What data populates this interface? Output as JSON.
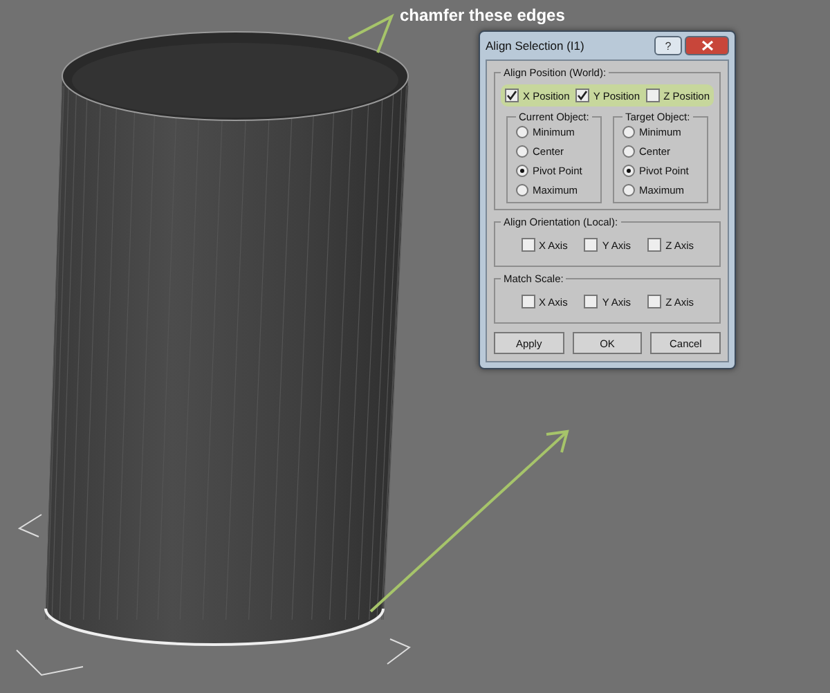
{
  "annotation": "chamfer these edges",
  "dialog": {
    "title": "Align Selection (I1)",
    "help": "?",
    "position": {
      "label": "Align Position (World):",
      "highlighted": true,
      "axes": [
        {
          "label": "X Position",
          "checked": true
        },
        {
          "label": "Y Position",
          "checked": true
        },
        {
          "label": "Z Position",
          "checked": false
        }
      ]
    },
    "groups": [
      {
        "label": "Current Object:",
        "options": [
          {
            "label": "Minimum",
            "selected": false
          },
          {
            "label": "Center",
            "selected": false
          },
          {
            "label": "Pivot Point",
            "selected": true
          },
          {
            "label": "Maximum",
            "selected": false
          }
        ]
      },
      {
        "label": "Target Object:",
        "options": [
          {
            "label": "Minimum",
            "selected": false
          },
          {
            "label": "Center",
            "selected": false
          },
          {
            "label": "Pivot Point",
            "selected": true
          },
          {
            "label": "Maximum",
            "selected": false
          }
        ]
      }
    ],
    "orientation": {
      "label": "Align Orientation (Local):",
      "axes": [
        {
          "label": "X Axis",
          "checked": false
        },
        {
          "label": "Y Axis",
          "checked": false
        },
        {
          "label": "Z Axis",
          "checked": false
        }
      ]
    },
    "scale": {
      "label": "Match Scale:",
      "axes": [
        {
          "label": "X Axis",
          "checked": false
        },
        {
          "label": "Y Axis",
          "checked": false
        },
        {
          "label": "Z Axis",
          "checked": false
        }
      ]
    },
    "buttons": [
      "Apply",
      "OK",
      "Cancel"
    ]
  }
}
